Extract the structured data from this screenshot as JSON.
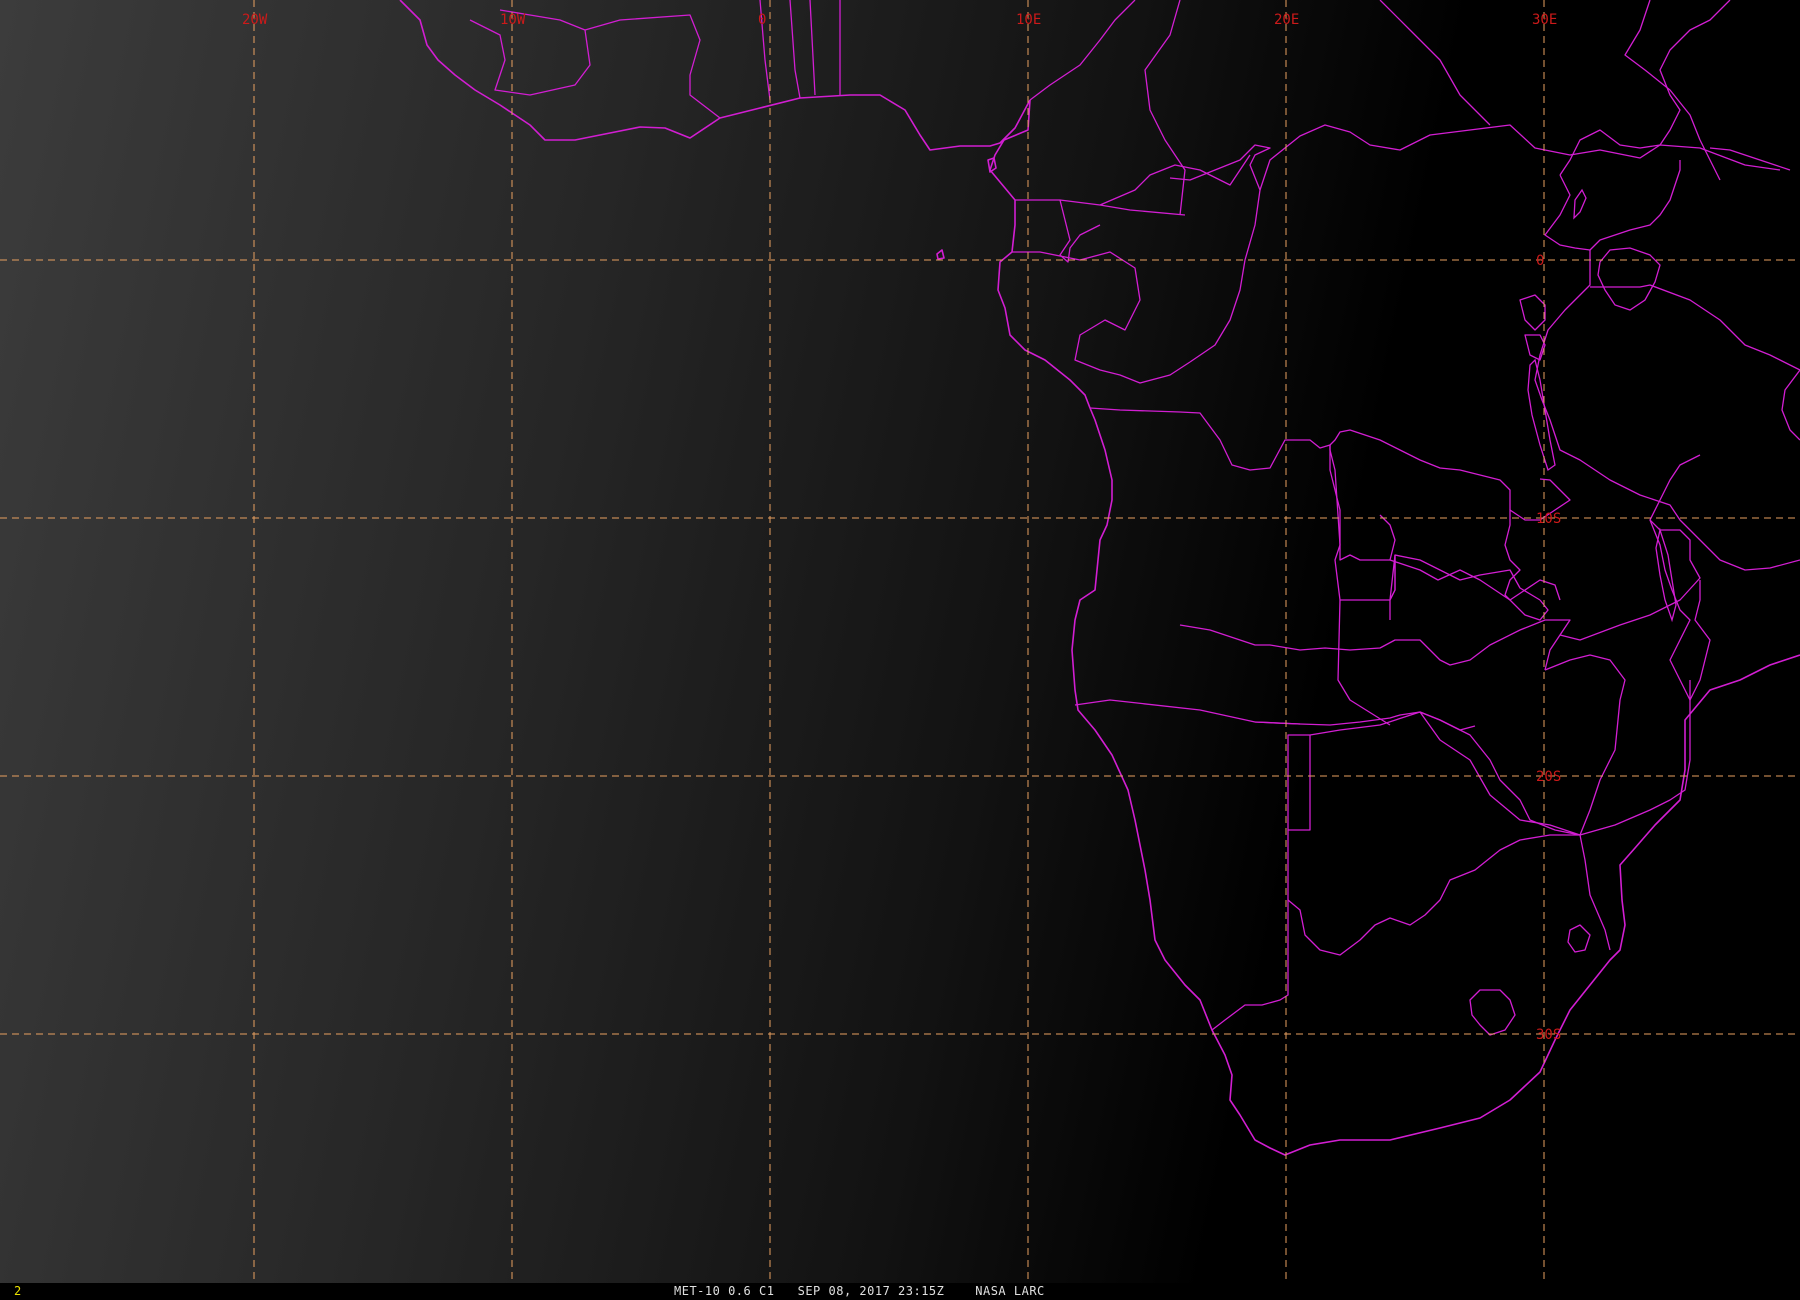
{
  "map": {
    "longitude_labels": [
      {
        "text": "20W",
        "lon": -20
      },
      {
        "text": "10W",
        "lon": -10
      },
      {
        "text": "0",
        "lon": 0
      },
      {
        "text": "10E",
        "lon": 10
      },
      {
        "text": "20E",
        "lon": 20
      },
      {
        "text": "30E",
        "lon": 30
      }
    ],
    "latitude_labels": [
      {
        "text": "0",
        "lat": 0
      },
      {
        "text": "10S",
        "lat": -10
      },
      {
        "text": "20S",
        "lat": -20
      },
      {
        "text": "30S",
        "lat": -30
      }
    ],
    "colors": {
      "background_left": "#3a3a3a",
      "background_right": "#000000",
      "coastline": "#d21ed2",
      "gridlines": "#e8a060",
      "grid_labels": "#cc1a1a"
    }
  },
  "status": {
    "frame_number": "2",
    "caption": "MET-10 0.6 C1   SEP 08, 2017 23:15Z    NASA LARC"
  }
}
